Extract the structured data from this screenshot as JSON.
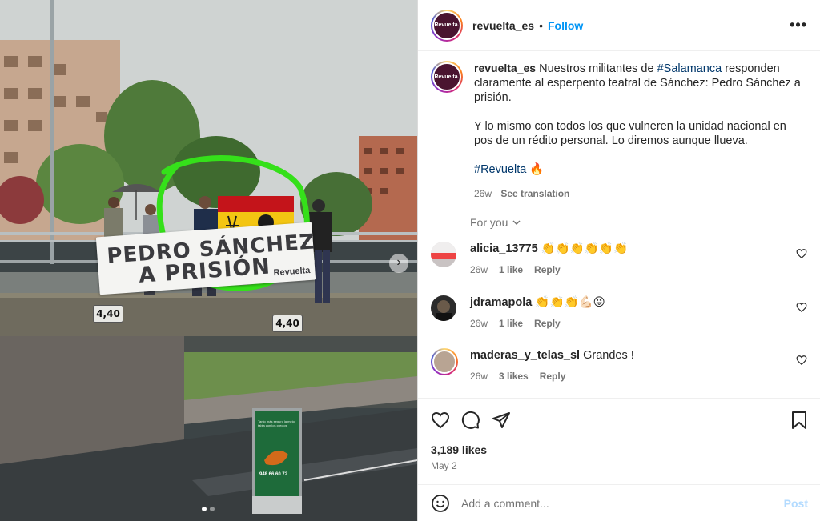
{
  "post": {
    "username": "revuelta_es",
    "avatar_text": "Revuelta.",
    "follow_label": "Follow",
    "more_icon": "more-horizontal-icon",
    "caption_text_pre": " Nuestros militantes de ",
    "caption_hashtag1": "#Salamanca",
    "caption_text_post": " responden claramente al esperpento teatral de Sánchez: Pedro Sánchez a prisión.",
    "caption_para2": "Y lo mismo con todos los que vulneren la unidad nacional en pos de un rédito personal. Lo diremos aunque llueva.",
    "caption_hashtag2": "#Revuelta",
    "caption_emoji": "🔥",
    "caption_age": "26w",
    "see_translation": "See translation",
    "for_you_label": "For you",
    "likes": "3,189 likes",
    "date": "May 2",
    "add_comment_placeholder": "Add a comment...",
    "post_label": "Post"
  },
  "photo": {
    "banner_line1": "PEDRO SÁNCHEZ",
    "banner_line2": "A PRISIÓN",
    "banner_brand": "Revuelta",
    "sign_left": "4,40",
    "sign_right": "4,40",
    "ad_text": "Tanto más seguro la mejor tabla con los precios",
    "ad_phone": "948 66 60 72",
    "carousel_count": 2,
    "carousel_active": 0
  },
  "comments": [
    {
      "username": "alicia_13775",
      "text": "👏👏👏👏👏👏",
      "age": "26w",
      "likes": "1 like",
      "reply": "Reply",
      "avatar_color": "#c9c3c3"
    },
    {
      "username": "jdramapola",
      "text": "👏👏👏💪🏻😜",
      "age": "26w",
      "likes": "1 like",
      "reply": "Reply",
      "avatar_color": "#2b2b2b"
    },
    {
      "username": "maderas_y_telas_sl",
      "text": " Grandes !",
      "age": "26w",
      "likes": "3 likes",
      "reply": "Reply",
      "avatar_color": "#b8a493"
    }
  ],
  "colors": {
    "follow_blue": "#0095f6",
    "hashtag": "#00376b",
    "muted": "#737373",
    "post_disabled": "#b3dbff"
  }
}
